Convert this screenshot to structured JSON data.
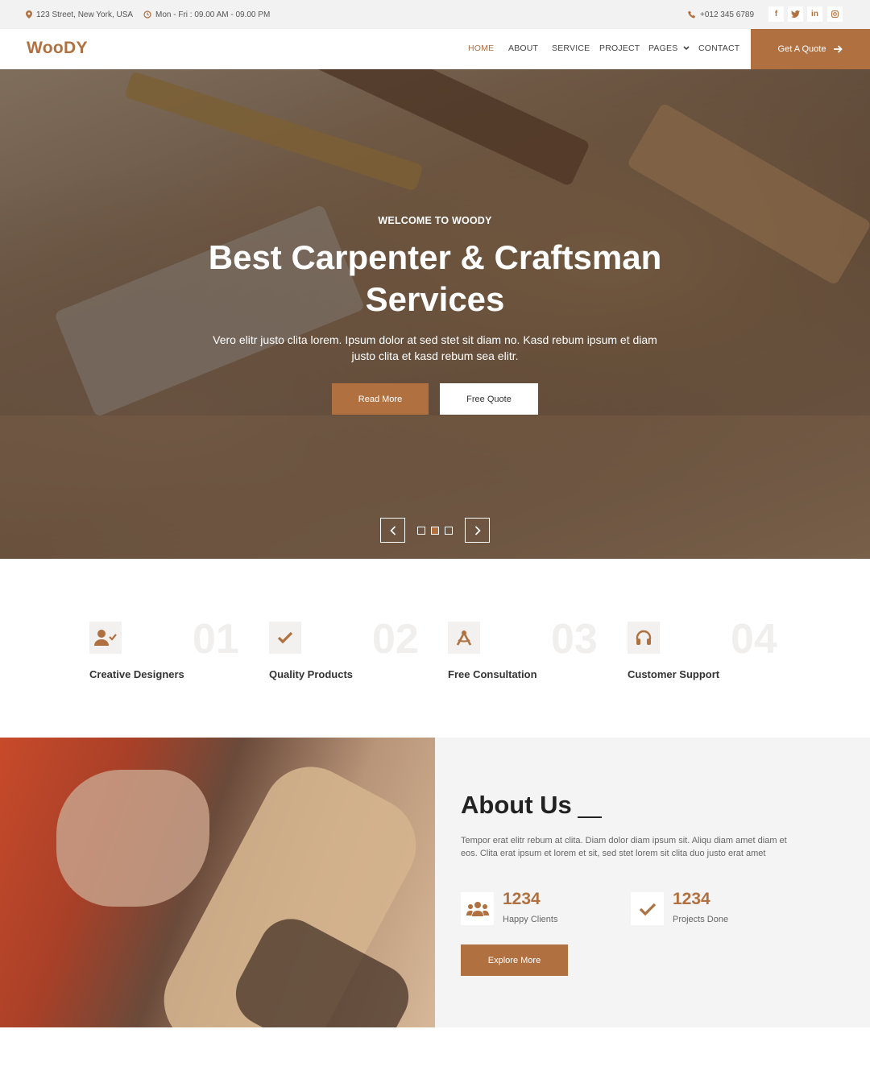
{
  "topbar": {
    "address": "123 Street, New York, USA",
    "hours": "Mon - Fri : 09.00 AM - 09.00 PM",
    "phone": "+012 345 6789",
    "social": [
      "f",
      "t",
      "in",
      "ig"
    ]
  },
  "nav": {
    "logo": "WooDY",
    "links": [
      "HOME",
      "ABOUT",
      "SERVICE",
      "PROJECT",
      "PAGES",
      "CONTACT"
    ],
    "cta": "Get A Quote"
  },
  "hero": {
    "subtitle": "WELCOME TO WOODY",
    "title_line1": "Best Carpenter & Craftsman",
    "title_line2": "Services",
    "text": "Vero elitr justo clita lorem. Ipsum dolor at sed stet sit diam no. Kasd rebum ipsum et diam justo clita et kasd rebum sea elitr.",
    "btn_primary": "Read More",
    "btn_secondary": "Free Quote"
  },
  "features": [
    {
      "num": "01",
      "title": "Creative Designers",
      "icon": "user-check-icon"
    },
    {
      "num": "02",
      "title": "Quality Products",
      "icon": "check-icon"
    },
    {
      "num": "03",
      "title": "Free Consultation",
      "icon": "compass-icon"
    },
    {
      "num": "04",
      "title": "Customer Support",
      "icon": "headphones-icon"
    }
  ],
  "about": {
    "title": "About Us",
    "text": "Tempor erat elitr rebum at clita. Diam dolor diam ipsum sit. Aliqu diam amet diam et eos. Clita erat ipsum et lorem et sit, sed stet lorem sit clita duo justo erat amet",
    "stats": [
      {
        "num": "1234",
        "label": "Happy Clients",
        "icon": "users-icon"
      },
      {
        "num": "1234",
        "label": "Projects Done",
        "icon": "check-icon"
      }
    ],
    "button": "Explore More"
  },
  "colors": {
    "accent": "#b07040",
    "topbar_bg": "#f2f2f2",
    "about_bg": "#f4f4f4"
  }
}
